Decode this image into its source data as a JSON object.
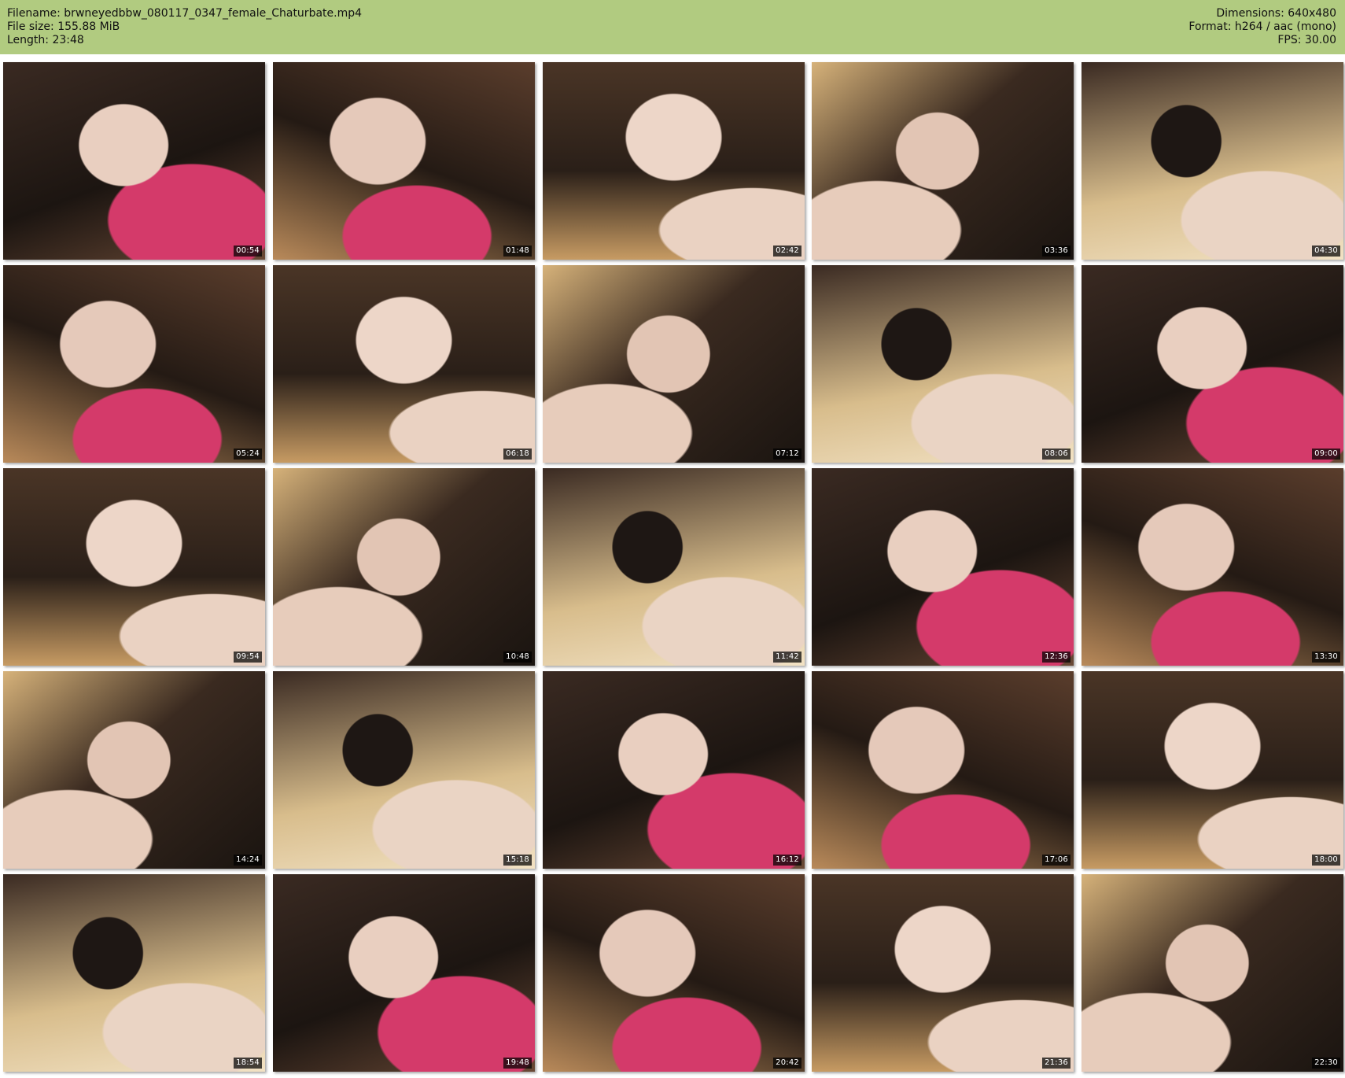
{
  "header": {
    "filename_line": "Filename: brwneyedbbw_080117_0347_female_Chaturbate.mp4",
    "filesize_line": "File size: 155.88 MiB",
    "length_line": "Length: 23:48",
    "dimensions_line": "Dimensions: 640x480",
    "format_line": "Format: h264 / aac (mono)",
    "fps_line": "FPS: 30.00"
  },
  "colors": {
    "header_bg": "#b1cb80",
    "page_bg": "#ffffff",
    "timestamp_bg": "#000000",
    "timestamp_text": "#ffffff",
    "tank_top_pink": "#d43a6a"
  },
  "thumbnails": [
    {
      "time": "00:54"
    },
    {
      "time": "01:48"
    },
    {
      "time": "02:42"
    },
    {
      "time": "03:36"
    },
    {
      "time": "04:30"
    },
    {
      "time": "05:24"
    },
    {
      "time": "06:18"
    },
    {
      "time": "07:12"
    },
    {
      "time": "08:06"
    },
    {
      "time": "09:00"
    },
    {
      "time": "09:54"
    },
    {
      "time": "10:48"
    },
    {
      "time": "11:42"
    },
    {
      "time": "12:36"
    },
    {
      "time": "13:30"
    },
    {
      "time": "14:24"
    },
    {
      "time": "15:18"
    },
    {
      "time": "16:12"
    },
    {
      "time": "17:06"
    },
    {
      "time": "18:00"
    },
    {
      "time": "18:54"
    },
    {
      "time": "19:48"
    },
    {
      "time": "20:42"
    },
    {
      "time": "21:36"
    },
    {
      "time": "22:30"
    }
  ]
}
